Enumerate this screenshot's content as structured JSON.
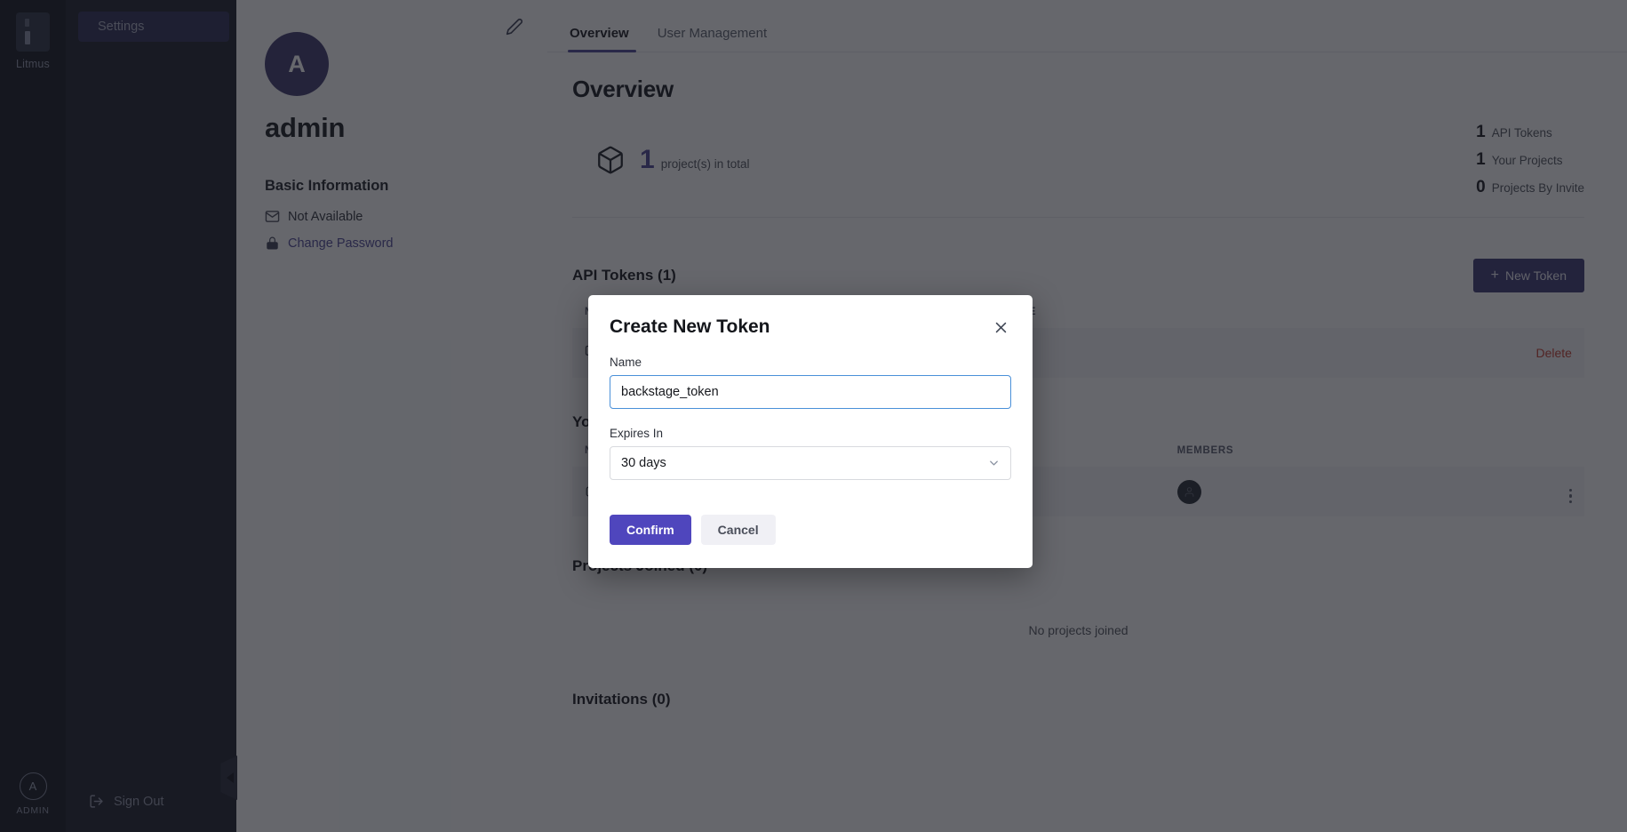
{
  "rail": {
    "brand_name": "Litmus",
    "brand_icon": "litmus-logo-icon",
    "avatar_letter": "A",
    "role_label": "ADMIN"
  },
  "nav": {
    "items": [
      {
        "label": "Settings",
        "active": true
      }
    ],
    "sign_out_label": "Sign Out",
    "sign_out_icon": "sign-out-icon",
    "collapse_icon": "collapse-left-icon"
  },
  "profile": {
    "edit_icon": "pencil-icon",
    "avatar_letter": "A",
    "username": "admin",
    "basic_information_title": "Basic Information",
    "email_icon": "envelope-icon",
    "email_value": "Not Available",
    "lock_icon": "lock-icon",
    "change_password_label": "Change Password"
  },
  "main": {
    "tabs": [
      {
        "label": "Overview",
        "active": true
      },
      {
        "label": "User Management",
        "active": false
      }
    ],
    "page_title": "Overview",
    "summary": {
      "cube_icon": "cube-icon",
      "projects_total_number": "1",
      "projects_total_label": "project(s) in total",
      "stats": [
        {
          "number": "1",
          "label": "API Tokens"
        },
        {
          "number": "1",
          "label": "Your Projects"
        },
        {
          "number": "0",
          "label": "Projects By Invite"
        }
      ]
    },
    "api_tokens": {
      "title": "API Tokens (1)",
      "new_token_button": "+ New Token",
      "new_token_plus": "+",
      "new_token_text": "New Token",
      "columns": [
        "NAME",
        "VALUE",
        ""
      ],
      "rows": [
        {
          "copy_icon": "copy-icon",
          "name": "",
          "value": "",
          "action": "Delete"
        }
      ]
    },
    "your_projects": {
      "title": "Your Projects (1)",
      "title_visible": "You",
      "columns": [
        "NAME",
        "",
        "MEMBERS",
        ""
      ],
      "rows": [
        {
          "icon": "cube-icon",
          "name": "",
          "id": "",
          "member_icon": "member-avatar-icon",
          "menu_icon": "kebab-menu-icon"
        }
      ]
    },
    "projects_joined": {
      "title": "Projects Joined (0)",
      "empty_text": "No projects joined"
    },
    "invitations": {
      "title": "Invitations (0)"
    }
  },
  "modal": {
    "title": "Create New Token",
    "close_icon": "close-icon",
    "name_label": "Name",
    "name_value": "backstage_token",
    "name_placeholder": "",
    "expires_label": "Expires In",
    "expires_value": "30 days",
    "expires_chevron_icon": "chevron-down-icon",
    "confirm_label": "Confirm",
    "cancel_label": "Cancel"
  },
  "colors": {
    "accent_purple": "#4f46bd",
    "dark_purple": "#3a3570",
    "rail_bg": "#11141d",
    "nav_bg": "#181b26",
    "nav_active": "#292b52",
    "delete_red": "#c0392b",
    "input_focus_border": "#4a90d9"
  }
}
